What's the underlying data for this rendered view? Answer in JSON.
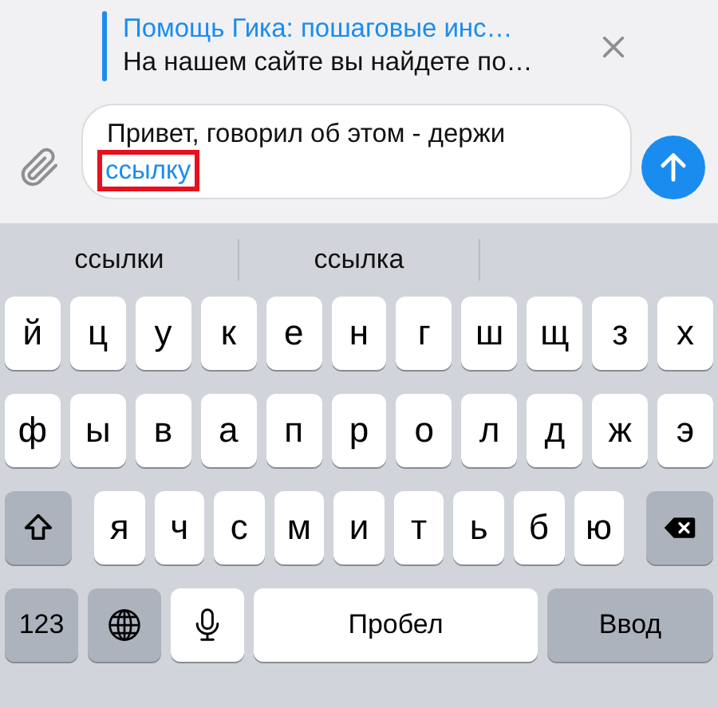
{
  "reply_preview": {
    "title": "Помощь Гика: пошаговые инс…",
    "subtitle": "На нашем сайте вы найдете по…"
  },
  "message": {
    "text": "Привет, говорил об этом - держи",
    "link": "ссылку",
    "link_highlighted": true
  },
  "suggestions": [
    "ссылки",
    "ссылка"
  ],
  "keyboard": {
    "letter_row_1": [
      {
        "label": "й"
      },
      {
        "label": "ц"
      },
      {
        "label": "у"
      },
      {
        "label": "к"
      },
      {
        "label": "е"
      },
      {
        "label": "н"
      },
      {
        "label": "г"
      },
      {
        "label": "ш"
      },
      {
        "label": "щ"
      },
      {
        "label": "з"
      },
      {
        "label": "х"
      }
    ],
    "letter_row_2": [
      {
        "label": "ф"
      },
      {
        "label": "ы"
      },
      {
        "label": "в"
      },
      {
        "label": "а"
      },
      {
        "label": "п"
      },
      {
        "label": "р"
      },
      {
        "label": "о"
      },
      {
        "label": "л"
      },
      {
        "label": "д"
      },
      {
        "label": "ж"
      },
      {
        "label": "э"
      }
    ],
    "letter_row_3": [
      {
        "kind": "shift"
      },
      {
        "label": "я"
      },
      {
        "label": "ч"
      },
      {
        "label": "с"
      },
      {
        "label": "м"
      },
      {
        "label": "и"
      },
      {
        "label": "т"
      },
      {
        "label": "ь"
      },
      {
        "label": "б"
      },
      {
        "label": "ю"
      },
      {
        "kind": "backspace"
      }
    ],
    "bottom_bar": [
      {
        "kind": "function",
        "label": "123"
      },
      {
        "kind": "globe"
      },
      {
        "kind": "mic"
      },
      {
        "kind": "space",
        "label": "Пробел"
      },
      {
        "kind": "return",
        "label": "Ввод"
      }
    ]
  }
}
